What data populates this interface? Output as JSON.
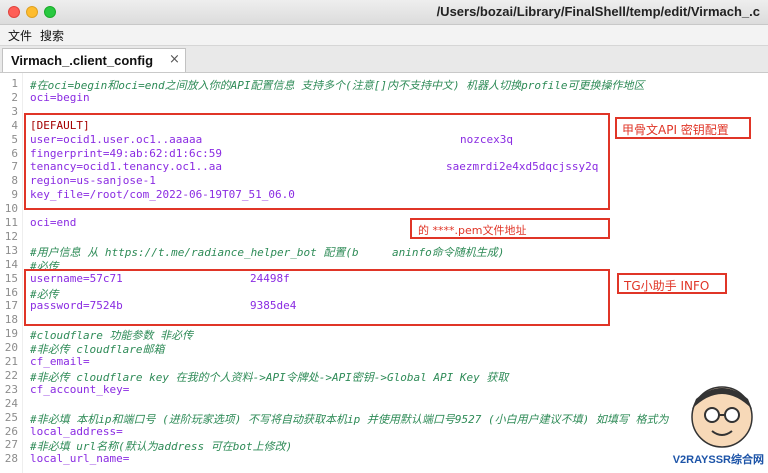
{
  "window": {
    "title": "/Users/bozai/Library/FinalShell/temp/edit/Virmach_.c"
  },
  "menu": {
    "file": "文件",
    "search": "搜索"
  },
  "tab": {
    "label": "Virmach_.client_config",
    "close": "×"
  },
  "lines": [
    {
      "n": "1",
      "t": "#在oci=begin和oci=end之间放入你的API配置信息 支持多个(注意[]内不支持中文) 机器人切换profile可更换操作地区"
    },
    {
      "n": "2",
      "t": "oci=begin"
    },
    {
      "n": "3",
      "t": ""
    },
    {
      "n": "4",
      "t": "[DEFAULT]"
    },
    {
      "n": "5",
      "t": "user=ocid1.user.oc1..aaaaa",
      "t2": "nozcex3q"
    },
    {
      "n": "6",
      "t": "fingerprint=49:ab:62:d1:6c:59"
    },
    {
      "n": "7",
      "t": "tenancy=ocid1.tenancy.oc1..aa",
      "t2": "saezmrdi2e4xd5dqcjssy2q"
    },
    {
      "n": "8",
      "t": "region=us-sanjose-1"
    },
    {
      "n": "9",
      "t": "key_file=/root/com_2022-06-19T07_51_06.0"
    },
    {
      "n": "10",
      "t": ""
    },
    {
      "n": "11",
      "t": "oci=end"
    },
    {
      "n": "12",
      "t": ""
    },
    {
      "n": "13",
      "t": "#用户信息 从 https://t.me/radiance_helper_bot 配置(b",
      "t2": "aninfo命令随机生成)"
    },
    {
      "n": "14",
      "t": "#必传"
    },
    {
      "n": "15",
      "t": "username=57c71",
      "t2": "24498f"
    },
    {
      "n": "16",
      "t": "#必传"
    },
    {
      "n": "17",
      "t": "password=7524b",
      "t2": "9385de4"
    },
    {
      "n": "18",
      "t": ""
    },
    {
      "n": "19",
      "t": "#cloudflare 功能参数 非必传"
    },
    {
      "n": "20",
      "t": "#非必传 cloudflare邮箱"
    },
    {
      "n": "21",
      "t": "cf_email="
    },
    {
      "n": "22",
      "t": "#非必传 cloudflare key 在我的个人资料->API令牌处->API密钥->Global API Key 获取"
    },
    {
      "n": "23",
      "t": "cf_account_key="
    },
    {
      "n": "24",
      "t": ""
    },
    {
      "n": "25",
      "t": "#非必填 本机ip和端口号 (进阶玩家选项) 不写将自动获取本机ip 并使用默认端口号9527 (小白用户建议不填) 如填写 格式为"
    },
    {
      "n": "26",
      "t": "local_address="
    },
    {
      "n": "27",
      "t": "#非必填 url名称(默认为address 可在bot上修改)"
    },
    {
      "n": "28",
      "t": "local_url_name="
    }
  ],
  "annotations": {
    "api": "甲骨文API 密钥配置",
    "pem": "的 ****.pem文件地址",
    "tg": "TG小助手 INFO"
  },
  "watermark": {
    "text": "V2RAYSSR综合网"
  },
  "colors": {
    "accent_red": "#e03527",
    "comment_green": "#2e8b57",
    "key_purple": "#8a2be2"
  }
}
